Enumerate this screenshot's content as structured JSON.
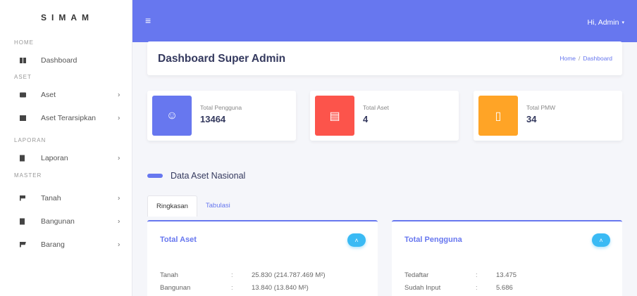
{
  "brand": "SIMAM",
  "sidebar": {
    "sections": [
      {
        "title": "HOME",
        "items": [
          {
            "label": "Dashboard"
          }
        ]
      },
      {
        "title": "ASET",
        "items": [
          {
            "label": "Aset"
          },
          {
            "label": "Aset Terarsipkan"
          }
        ]
      },
      {
        "title": "LAPORAN",
        "items": [
          {
            "label": "Laporan"
          }
        ]
      },
      {
        "title": "MASTER",
        "items": [
          {
            "label": "Tanah"
          },
          {
            "label": "Bangunan"
          },
          {
            "label": "Barang"
          }
        ]
      }
    ],
    "chevron": "›"
  },
  "topbar": {
    "menu_icon": "≡",
    "user_label": "Hi, Admin",
    "caret": "▾"
  },
  "header": {
    "title": "Dashboard Super Admin",
    "breadcrumb_home": "Home",
    "breadcrumb_sep": "/",
    "breadcrumb_current": "Dashboard"
  },
  "stats": [
    {
      "label": "Total Pengguna",
      "value": "13464",
      "icon": "user-icon",
      "glyph": "☺",
      "color": "#6777ef"
    },
    {
      "label": "Total Aset",
      "value": "4",
      "icon": "id-card-icon",
      "glyph": "▤",
      "color": "#fc544b"
    },
    {
      "label": "Total PMW",
      "value": "34",
      "icon": "document-icon",
      "glyph": "▯",
      "color": "#ffa426"
    }
  ],
  "section_title": "Data Aset Nasional",
  "tabs": [
    {
      "label": "Ringkasan",
      "active": true
    },
    {
      "label": "Tabulasi",
      "active": false
    }
  ],
  "panels": [
    {
      "title": "Total Aset",
      "rows": [
        {
          "key": "Tanah",
          "sep": ":",
          "value": "25.830 (214.787.469 M²)"
        },
        {
          "key": "Bangunan",
          "sep": ":",
          "value": "13.840 (13.840 M²)"
        }
      ]
    },
    {
      "title": "Total Pengguna",
      "rows": [
        {
          "key": "Tedaftar",
          "sep": ":",
          "value": "13.475"
        },
        {
          "key": "Sudah Input",
          "sep": ":",
          "value": "5.686"
        }
      ]
    }
  ],
  "collapse_glyph": "˄",
  "colors": {
    "primary": "#6777ef",
    "danger": "#fc544b",
    "warning": "#ffa426",
    "info": "#3abaf4"
  }
}
